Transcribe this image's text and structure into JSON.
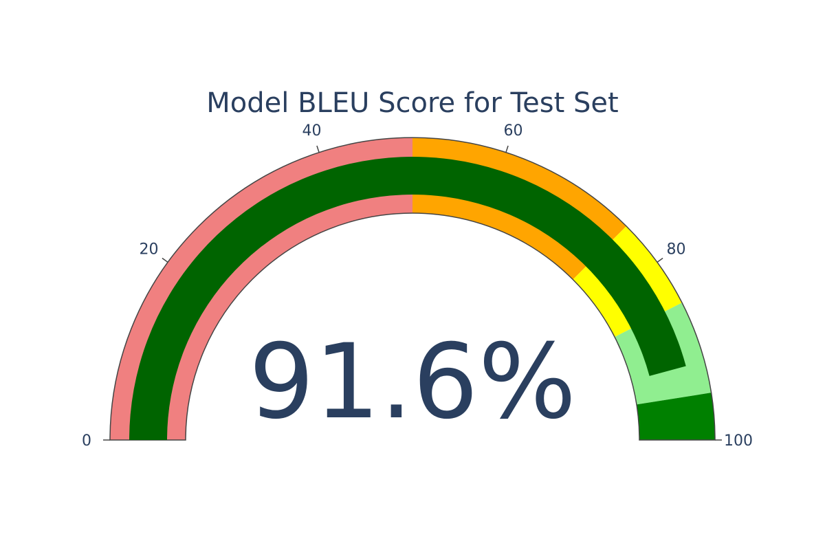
{
  "chart_data": {
    "type": "gauge",
    "title": "Model BLEU Score for Test Set",
    "value": 91.6,
    "suffix": "%",
    "axis_range": [
      0,
      100
    ],
    "ticks": [
      0,
      20,
      40,
      60,
      80,
      100
    ],
    "tick_labels": [
      "0",
      "20",
      "40",
      "60",
      "80",
      "100"
    ],
    "bar_color": "#006400",
    "steps": [
      {
        "range": [
          0,
          50
        ],
        "color": "#f08080"
      },
      {
        "range": [
          50,
          75
        ],
        "color": "#ffa500"
      },
      {
        "range": [
          75,
          85
        ],
        "color": "#ffff00"
      },
      {
        "range": [
          85,
          95
        ],
        "color": "#90ee90"
      },
      {
        "range": [
          95,
          100
        ],
        "color": "#008000"
      }
    ],
    "text_color": "#2a3f5f",
    "border_color": "#444444"
  }
}
